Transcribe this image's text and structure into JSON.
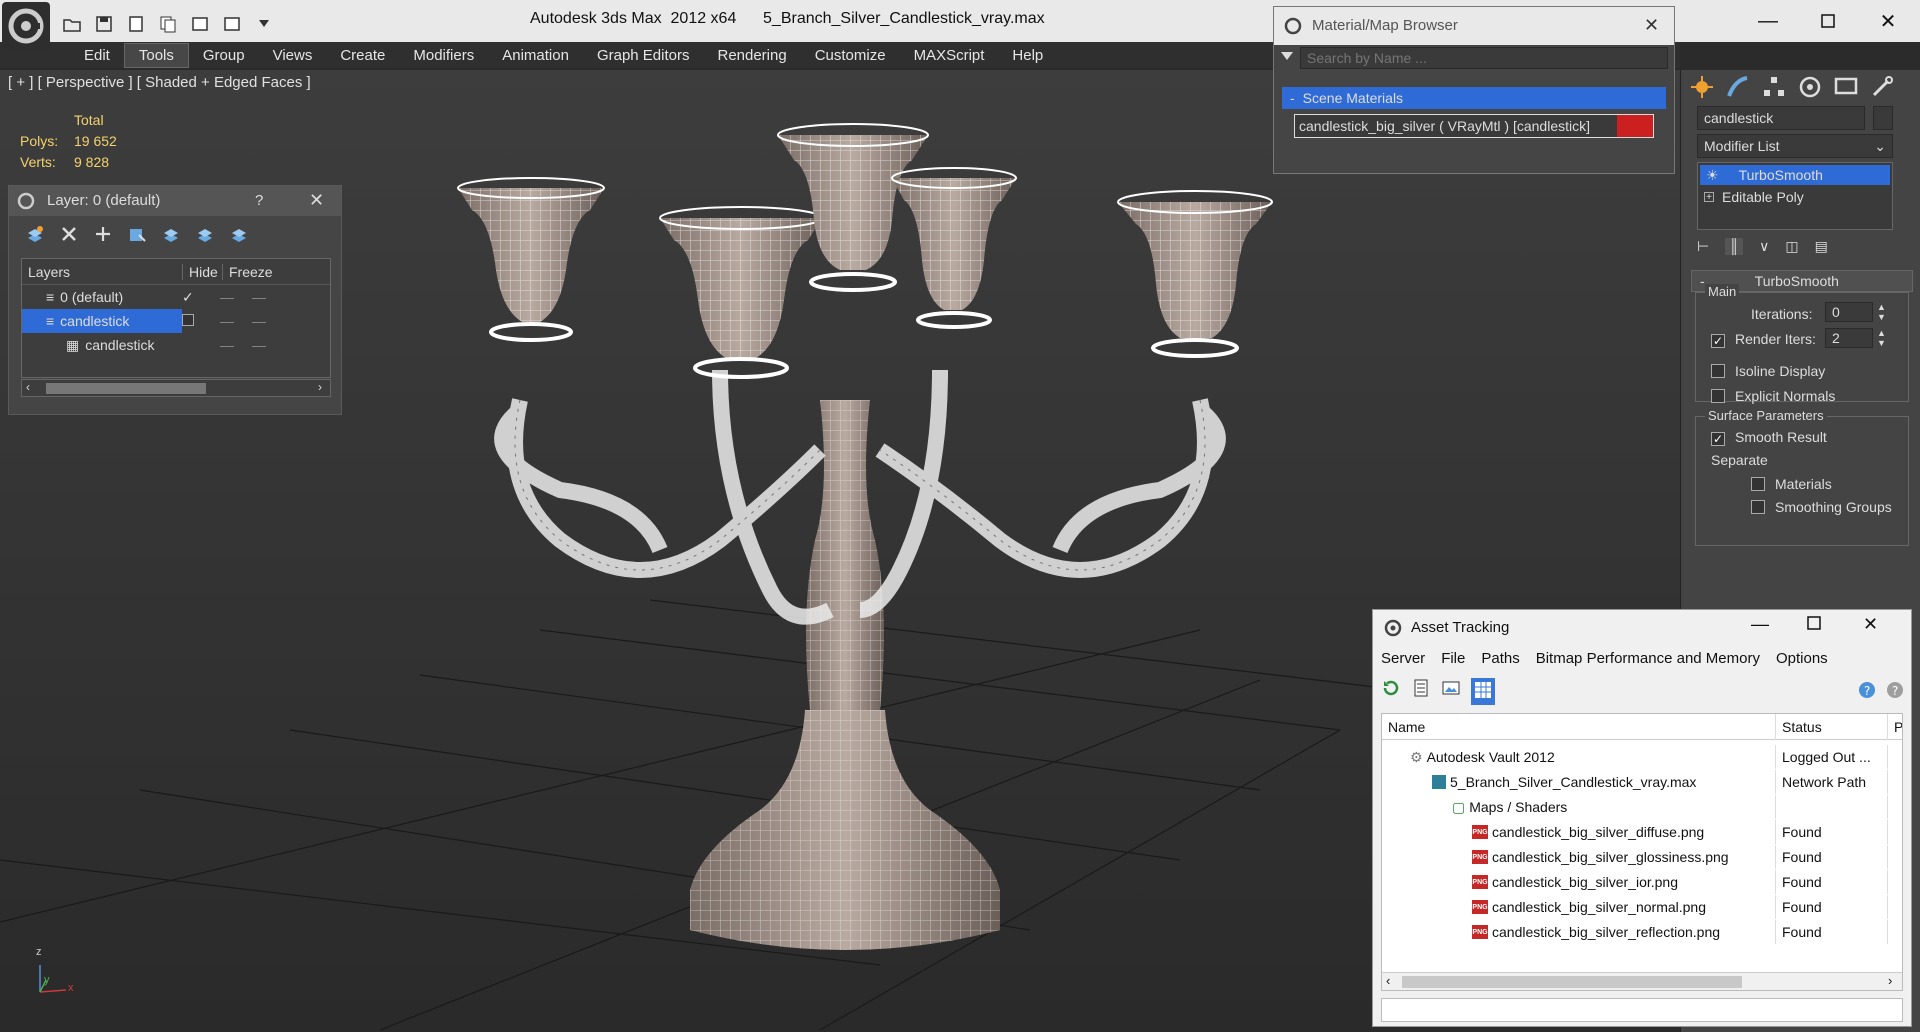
{
  "window": {
    "title": "Autodesk 3ds Max  2012 x64      5_Branch_Silver_Candlestick_vray.max",
    "minimize_icon": "minimize-icon",
    "maximize_icon": "maximize-icon",
    "close_icon": "close-icon"
  },
  "menubar": {
    "items": [
      "Edit",
      "Tools",
      "Group",
      "Views",
      "Create",
      "Modifiers",
      "Animation",
      "Graph Editors",
      "Rendering",
      "Customize",
      "MAXScript",
      "Help"
    ],
    "active": "Tools"
  },
  "viewport": {
    "label": "[ + ] [ Perspective ] [ Shaded + Edged Faces ]",
    "stats": {
      "total_label": "Total",
      "polys_label": "Polys:",
      "polys_value": "19 652",
      "verts_label": "Verts:",
      "verts_value": "9 828"
    },
    "axis_labels": {
      "z": "z",
      "y": "y",
      "x": "x"
    }
  },
  "layer_dialog": {
    "title": "Layer: 0 (default)",
    "help": "?",
    "columns": [
      "Layers",
      "Hide",
      "Freeze"
    ],
    "rows": [
      {
        "name": "0 (default)",
        "checked": true,
        "selected": false
      },
      {
        "name": "candlestick",
        "checked": false,
        "selected": true
      },
      {
        "name": "candlestick",
        "checked": false,
        "selected": false
      }
    ]
  },
  "material_browser": {
    "title": "Material/Map Browser",
    "search_placeholder": "Search by Name ...",
    "section_title": "Scene Materials",
    "section_toggle": "-",
    "material": "candlestick_big_silver  ( VRayMtl ) [candlestick]",
    "material_color": "#cc1f1f"
  },
  "command_panel": {
    "object_name": "candlestick",
    "modifier_list": "Modifier List",
    "stack": [
      {
        "name": "TurboSmooth",
        "selected": true
      },
      {
        "name": "Editable Poly",
        "selected": false
      }
    ],
    "rollout_title": "TurboSmooth",
    "rollout_toggle": "-",
    "main_group": "Main",
    "iterations_label": "Iterations:",
    "iterations_value": "0",
    "render_iters_label": "Render Iters:",
    "render_iters_value": "2",
    "isoline_label": "Isoline Display",
    "explicit_normals_label": "Explicit Normals",
    "surface_group": "Surface Parameters",
    "smooth_result_label": "Smooth Result",
    "separate_label": "Separate",
    "materials_label": "Materials",
    "smoothing_groups_label": "Smoothing Groups"
  },
  "asset_tracking": {
    "title": "Asset Tracking",
    "menu": [
      "Server",
      "File",
      "Paths",
      "Bitmap Performance and Memory",
      "Options"
    ],
    "columns": [
      "Name",
      "Status",
      "P"
    ],
    "rows": [
      {
        "name": "Autodesk Vault 2012",
        "status": "Logged Out ...",
        "indent": 1,
        "icon": "vault-icon"
      },
      {
        "name": "5_Branch_Silver_Candlestick_vray.max",
        "status": "Network Path",
        "indent": 2,
        "icon": "max-file-icon"
      },
      {
        "name": "Maps / Shaders",
        "status": "",
        "indent": 3,
        "icon": "maps-icon"
      },
      {
        "name": "candlestick_big_silver_diffuse.png",
        "status": "Found",
        "indent": 4,
        "icon": "png-icon"
      },
      {
        "name": "candlestick_big_silver_glossiness.png",
        "status": "Found",
        "indent": 4,
        "icon": "png-icon"
      },
      {
        "name": "candlestick_big_silver_ior.png",
        "status": "Found",
        "indent": 4,
        "icon": "png-icon"
      },
      {
        "name": "candlestick_big_silver_normal.png",
        "status": "Found",
        "indent": 4,
        "icon": "png-icon"
      },
      {
        "name": "candlestick_big_silver_reflection.png",
        "status": "Found",
        "indent": 4,
        "icon": "png-icon"
      }
    ],
    "png_label": "PNG"
  }
}
